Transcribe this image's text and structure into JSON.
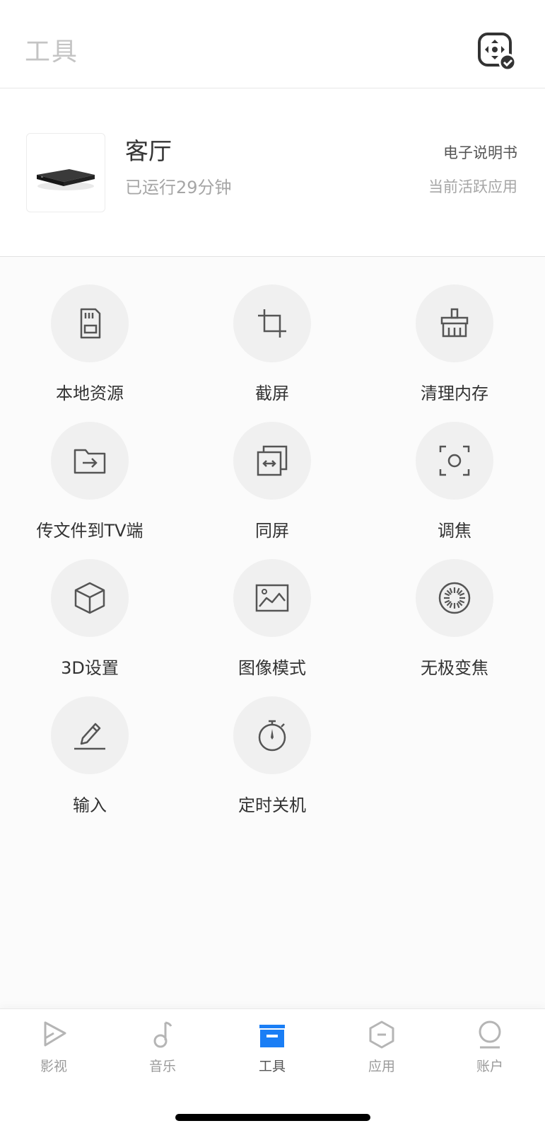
{
  "header": {
    "title": "工具",
    "remote_icon": "remote-control-icon"
  },
  "device": {
    "name": "客厅",
    "status": "已运行29分钟",
    "manual_link": "电子说明书",
    "active_apps_link": "当前活跃应用"
  },
  "tools": [
    {
      "label": "本地资源",
      "icon": "sd-card-icon"
    },
    {
      "label": "截屏",
      "icon": "crop-icon"
    },
    {
      "label": "清理内存",
      "icon": "broom-icon"
    },
    {
      "label": "传文件到TV端",
      "icon": "folder-transfer-icon"
    },
    {
      "label": "同屏",
      "icon": "screen-mirror-icon"
    },
    {
      "label": "调焦",
      "icon": "focus-icon"
    },
    {
      "label": "3D设置",
      "icon": "cube-icon"
    },
    {
      "label": "图像模式",
      "icon": "picture-icon"
    },
    {
      "label": "无极变焦",
      "icon": "zoom-dial-icon"
    },
    {
      "label": "输入",
      "icon": "pencil-icon"
    },
    {
      "label": "定时关机",
      "icon": "stopwatch-icon"
    }
  ],
  "tabbar": {
    "items": [
      {
        "label": "影视",
        "icon": "play-icon",
        "active": false
      },
      {
        "label": "音乐",
        "icon": "music-note-icon",
        "active": false
      },
      {
        "label": "工具",
        "icon": "toolbox-icon",
        "active": true
      },
      {
        "label": "应用",
        "icon": "apps-hexagon-icon",
        "active": false
      },
      {
        "label": "账户",
        "icon": "account-icon",
        "active": false
      }
    ],
    "active_color": "#1a7ef5",
    "inactive_color": "#b5b5b5"
  }
}
